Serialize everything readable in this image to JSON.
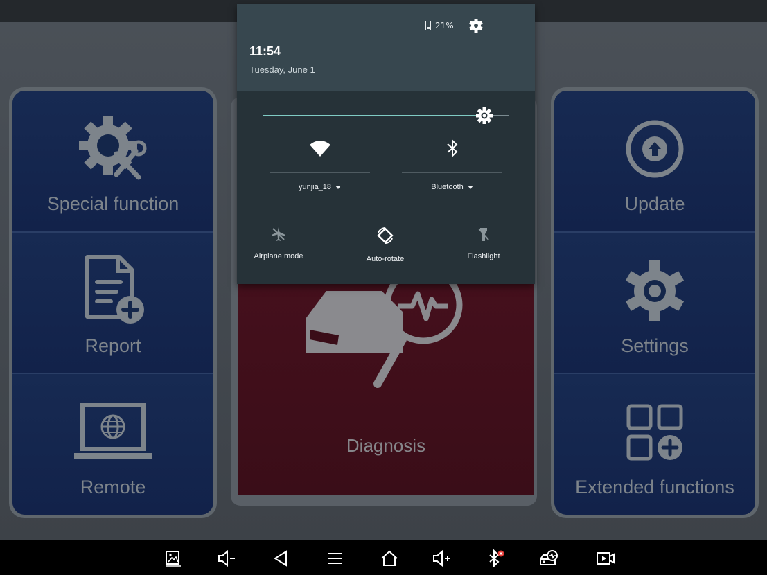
{
  "colors": {
    "accent": "#80cbc4",
    "tile_bg": "#14264a",
    "diagnosis_bg": "#4e1220",
    "shade_bg": "#263238"
  },
  "left_tiles": [
    {
      "label": "Special function",
      "icon": "gear-wrench-icon"
    },
    {
      "label": "Report",
      "icon": "document-add-icon"
    },
    {
      "label": "Remote",
      "icon": "laptop-globe-icon"
    }
  ],
  "right_tiles": [
    {
      "label": "Update",
      "icon": "upload-circle-icon"
    },
    {
      "label": "Settings",
      "icon": "gear-icon"
    },
    {
      "label": "Extended functions",
      "icon": "grid-add-icon"
    }
  ],
  "center_tile": {
    "label": "Diagnosis",
    "icon": "car-magnifier-icon"
  },
  "notification_shade": {
    "battery": "21%",
    "time": "11:54",
    "date": "Tuesday, June 1",
    "brightness": 0.9,
    "wifi_label": "yunjia_18",
    "bluetooth_label": "Bluetooth",
    "quick_tiles": [
      "Airplane mode",
      "Auto-rotate",
      "Flashlight"
    ]
  },
  "navbar": [
    "screenshot-icon",
    "volume-down-icon",
    "back-icon",
    "menu-icon",
    "home-icon",
    "volume-up-icon",
    "bluetooth-off-icon",
    "car-diagnosis-icon",
    "screen-record-icon"
  ]
}
